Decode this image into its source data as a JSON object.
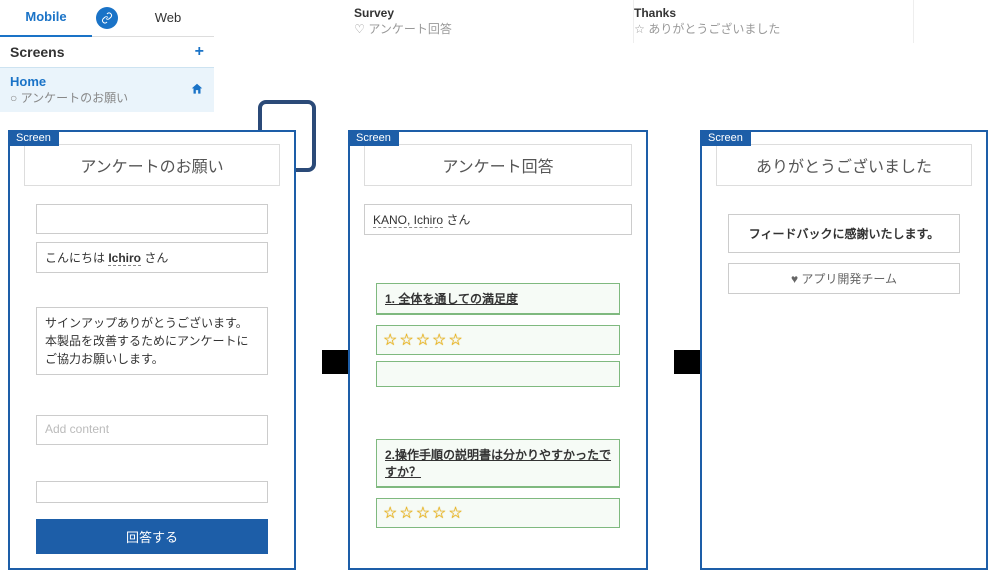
{
  "tabs": {
    "mobile": "Mobile",
    "web": "Web"
  },
  "screens_header": "Screens",
  "home_item": {
    "title": "Home",
    "subtitle": "アンケートのお願い"
  },
  "breadcrumbs": [
    {
      "title": "Survey",
      "icon": "♡",
      "subtitle": "アンケート回答"
    },
    {
      "title": "Thanks",
      "icon": "☆",
      "subtitle": "ありがとうございました"
    }
  ],
  "screen_tag": "Screen",
  "screen1": {
    "header": "アンケートのお願い",
    "greeting_pre": "こんにちは ",
    "greeting_name": "Ichiro",
    "greeting_post": " さん",
    "message": "サインアップありがとうございます。本製品を改善するためにアンケートにご協力お願いします。",
    "placeholder": "Add content",
    "button": "回答する"
  },
  "screen2": {
    "header": "アンケート回答",
    "user": "KANO, Ichiro",
    "user_suffix": " さん",
    "q1": "1. 全体を通しての満足度",
    "q2": "2.操作手順の説明書は分かりやすかったですか？",
    "stars": "☆☆☆☆☆"
  },
  "screen3": {
    "header": "ありがとうございました",
    "thanks": "フィードバックに感謝いたします。",
    "team_icon": "♥",
    "team": " アプリ開発チーム"
  }
}
